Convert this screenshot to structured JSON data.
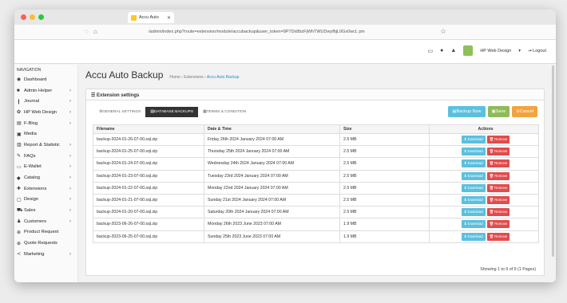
{
  "browser": {
    "tab_title": "Accu Auto",
    "url": "/admin/index.php?route=extension/module/accubackup&user_token=9P7Dx8bzFjWhTWUDwyfbjL0Gx0wcL pin"
  },
  "header": {
    "user": "HP Web Design"
  },
  "nav": {
    "heading": "NAVIGATION",
    "items": [
      {
        "label": "Dashboard",
        "icon": "dashboard-icon",
        "chev": ""
      },
      {
        "label": "Admin Helper",
        "icon": "admin-icon",
        "chev": "›"
      },
      {
        "label": "Journal",
        "icon": "journal-icon",
        "chev": "›"
      },
      {
        "label": "HP Web Design",
        "icon": "design-icon",
        "chev": "›"
      },
      {
        "label": "F-Blog",
        "icon": "blog-icon",
        "chev": "›"
      },
      {
        "label": "Media",
        "icon": "media-icon",
        "chev": ""
      },
      {
        "label": "Report & Statistic",
        "icon": "report-icon",
        "chev": "›"
      },
      {
        "label": "FAQs",
        "icon": "faq-icon",
        "chev": "›"
      },
      {
        "label": "E-Wallet",
        "icon": "wallet-icon",
        "chev": "›"
      },
      {
        "label": "Catalog",
        "icon": "catalog-icon",
        "chev": "›"
      },
      {
        "label": "Extensions",
        "icon": "extensions-icon",
        "chev": "›"
      },
      {
        "label": "Design",
        "icon": "monitor-icon",
        "chev": "›"
      },
      {
        "label": "Sales",
        "icon": "cart-icon",
        "chev": "›"
      },
      {
        "label": "Customers",
        "icon": "user-icon",
        "chev": "›"
      },
      {
        "label": "Product Request",
        "icon": "request-icon",
        "chev": ""
      },
      {
        "label": "Quote Requests",
        "icon": "quote-icon",
        "chev": ""
      },
      {
        "label": "Marketing",
        "icon": "share-icon",
        "chev": "›"
      }
    ]
  },
  "page": {
    "title": "Accu Auto Backup",
    "crumb_home": "Home",
    "crumb_ext": "Extensions",
    "crumb_current": "Accu Auto Backup"
  },
  "panel": {
    "heading": "Extension settings",
    "tabs": [
      "GENERAL SETTINGS",
      "DATABASE BACKUPS",
      "TERMS & CONDITION"
    ],
    "backup_btn": "Backup Now",
    "save_btn": "Save",
    "cancel_btn": "Cancel",
    "columns": [
      "Filename",
      "Date & Time",
      "Size",
      "Actions"
    ],
    "download_label": "Download",
    "remove_label": "Remove",
    "footer": "Showing 1 to 9 of 9 (1 Pages)"
  },
  "rows": [
    {
      "file": "backup-2024-01-26-07-00.sql.zip",
      "date": "Friday 26th 2024 January 2024 07:00 AM",
      "size": "2.5 MB"
    },
    {
      "file": "backup-2024-01-25-07-00.sql.zip",
      "date": "Thursday 25th 2024 January 2024 07:00 AM",
      "size": "2.5 MB"
    },
    {
      "file": "backup-2024-01-24-07-00.sql.zip",
      "date": "Wednesday 24th 2024 January 2024 07:00 AM",
      "size": "2.5 MB"
    },
    {
      "file": "backup-2024-01-23-07-00.sql.zip",
      "date": "Tuesday 23rd 2024 January 2024 07:00 AM",
      "size": "2.5 MB"
    },
    {
      "file": "backup-2024-01-22-07-00.sql.zip",
      "date": "Monday 22nd 2024 January 2024 07:00 AM",
      "size": "2.5 MB"
    },
    {
      "file": "backup-2024-01-21-07-00.sql.zip",
      "date": "Sunday 21st 2024 January 2024 07:00 AM",
      "size": "2.5 MB"
    },
    {
      "file": "backup-2024-01-20-07-00.sql.zip",
      "date": "Saturday 20th 2024 January 2024 07:00 AM",
      "size": "2.5 MB"
    },
    {
      "file": "backup-2023-06-26-07-00.sql.zip",
      "date": "Monday 26th 2023 June 2023 07:00 AM",
      "size": "1.9 MB"
    },
    {
      "file": "backup-2023-06-25-07-00.sql.zip",
      "date": "Sunday 25th 2023 June 2023 07:00 AM",
      "size": "1.9 MB"
    }
  ]
}
